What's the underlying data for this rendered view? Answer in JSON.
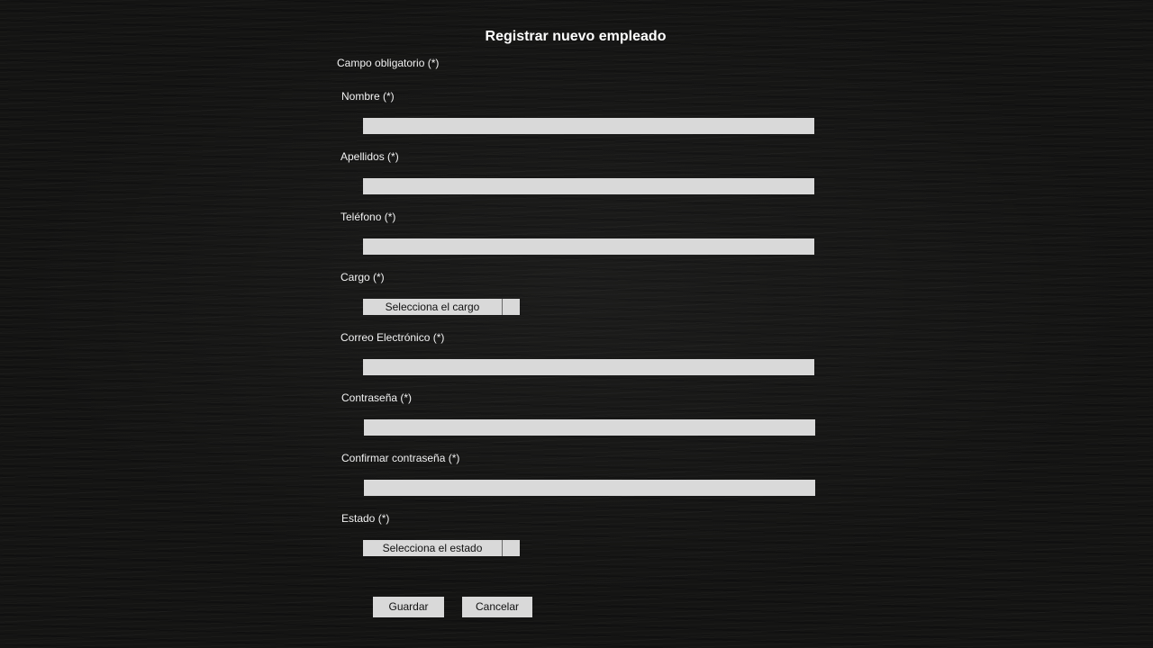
{
  "form": {
    "title": "Registrar nuevo empleado",
    "required_note": "Campo obligatorio (*)",
    "fields": {
      "nombre": {
        "label": "Nombre (*)",
        "value": ""
      },
      "apellidos": {
        "label": "Apellidos (*)",
        "value": ""
      },
      "telefono": {
        "label": "Teléfono (*)",
        "value": ""
      },
      "cargo": {
        "label": "Cargo (*)",
        "selected": "Selecciona el cargo"
      },
      "correo": {
        "label": "Correo Electrónico (*)",
        "value": ""
      },
      "contrasena": {
        "label": "Contraseña (*)",
        "value": ""
      },
      "confirmar": {
        "label": "Confirmar contraseña (*)",
        "value": ""
      },
      "estado": {
        "label": "Estado (*)",
        "selected": "Selecciona el estado"
      }
    },
    "buttons": {
      "save": "Guardar",
      "cancel": "Cancelar"
    }
  },
  "colors": {
    "background": "#141413",
    "field": "#d9d9d9",
    "text": "#f2f2f2",
    "button_text": "#111111"
  }
}
